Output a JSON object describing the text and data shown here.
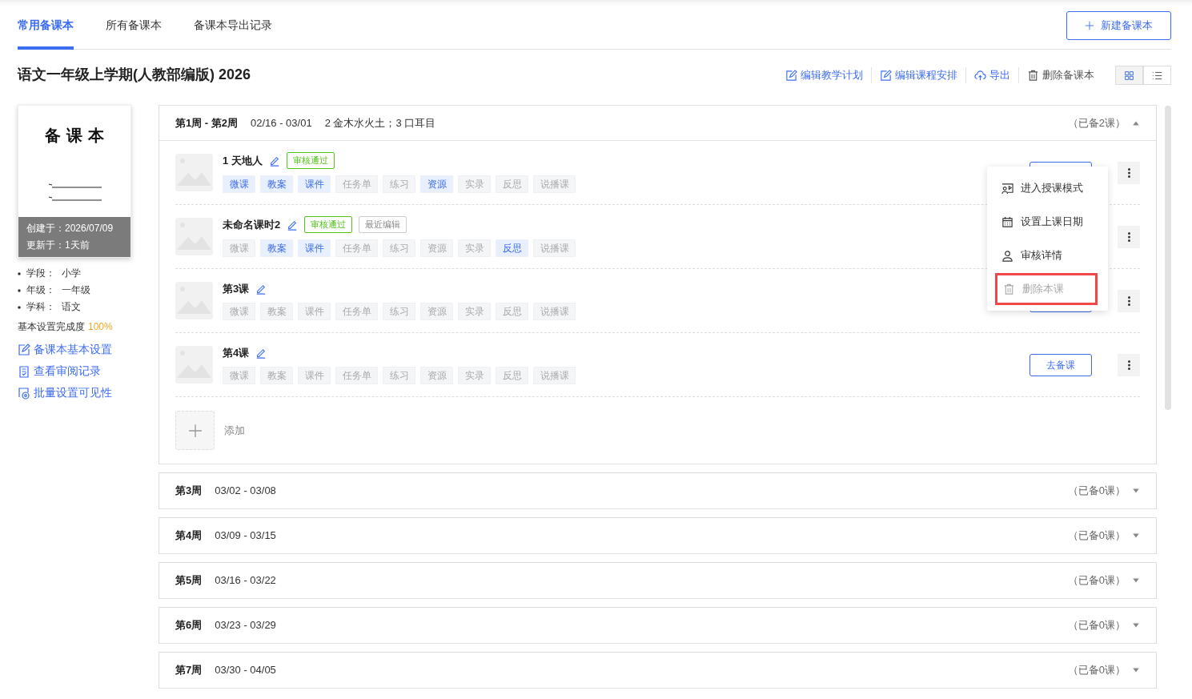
{
  "tabs": [
    {
      "label": "常用备课本",
      "selected": true
    },
    {
      "label": "所有备课本",
      "selected": false
    },
    {
      "label": "备课本导出记录",
      "selected": false
    }
  ],
  "new_button": {
    "label": "新建备课本"
  },
  "title": "语文一年级上学期(人教部编版) 2026",
  "actions": [
    {
      "label": "编辑教学计划",
      "kind": "edit"
    },
    {
      "label": "编辑课程安排",
      "kind": "edit"
    },
    {
      "label": "导出",
      "kind": "export"
    },
    {
      "label": "删除备课本",
      "kind": "delete"
    }
  ],
  "view_toggle": [
    {
      "kind": "grid",
      "selected": true
    },
    {
      "kind": "list",
      "selected": false
    }
  ],
  "cover": {
    "title": "备 课 本",
    "created": "创建于：2026/07/09",
    "updated": "更新于：1天前"
  },
  "info": [
    {
      "label": "学段：",
      "value": "小学"
    },
    {
      "label": "年级：",
      "value": "一年级"
    },
    {
      "label": "学科：",
      "value": "语文"
    }
  ],
  "completion": {
    "label": "基本设置完成度",
    "value": "100%"
  },
  "links": [
    {
      "label": "备课本基本设置",
      "kind": "settings"
    },
    {
      "label": "查看审阅记录",
      "kind": "record"
    },
    {
      "label": "批量设置可见性",
      "kind": "visibility"
    }
  ],
  "weeks": [
    {
      "name": "第1周 - 第2周",
      "dates": "02/16 - 03/01",
      "topics": "2 金木水火土；3 口耳目",
      "count": "（已备2课）",
      "expanded": true,
      "lessons": [
        {
          "title": "1 天地人",
          "badges": [
            {
              "label": "审核通过",
              "kind": "approved"
            }
          ],
          "tags": [
            {
              "label": "微课",
              "on": true
            },
            {
              "label": "教案",
              "on": true
            },
            {
              "label": "课件",
              "on": true
            },
            {
              "label": "任务单",
              "on": false
            },
            {
              "label": "练习",
              "on": false
            },
            {
              "label": "资源",
              "on": true
            },
            {
              "label": "实录",
              "on": false
            },
            {
              "label": "反思",
              "on": false
            },
            {
              "label": "说播课",
              "on": false
            }
          ]
        },
        {
          "title": "未命名课时2",
          "badges": [
            {
              "label": "审核通过",
              "kind": "approved"
            },
            {
              "label": "最近编辑",
              "kind": "recent"
            }
          ],
          "tags": [
            {
              "label": "微课",
              "on": false
            },
            {
              "label": "教案",
              "on": true
            },
            {
              "label": "课件",
              "on": true
            },
            {
              "label": "任务单",
              "on": false
            },
            {
              "label": "练习",
              "on": false
            },
            {
              "label": "资源",
              "on": false
            },
            {
              "label": "实录",
              "on": false
            },
            {
              "label": "反思",
              "on": true
            },
            {
              "label": "说播课",
              "on": false
            }
          ]
        },
        {
          "title": "第3课",
          "tags": [
            {
              "label": "微课",
              "on": false
            },
            {
              "label": "教案",
              "on": false
            },
            {
              "label": "课件",
              "on": false
            },
            {
              "label": "任务单",
              "on": false
            },
            {
              "label": "练习",
              "on": false
            },
            {
              "label": "资源",
              "on": false
            },
            {
              "label": "实录",
              "on": false
            },
            {
              "label": "反思",
              "on": false
            },
            {
              "label": "说播课",
              "on": false
            }
          ]
        },
        {
          "title": "第4课",
          "button": "去备课",
          "tags": [
            {
              "label": "微课",
              "on": false
            },
            {
              "label": "教案",
              "on": false
            },
            {
              "label": "课件",
              "on": false
            },
            {
              "label": "任务单",
              "on": false
            },
            {
              "label": "练习",
              "on": false
            },
            {
              "label": "资源",
              "on": false
            },
            {
              "label": "实录",
              "on": false
            },
            {
              "label": "反思",
              "on": false
            },
            {
              "label": "说播课",
              "on": false
            }
          ]
        }
      ],
      "add_label": "添加"
    },
    {
      "name": "第3周",
      "dates": "03/02 - 03/08",
      "count": "（已备0课）",
      "expanded": false
    },
    {
      "name": "第4周",
      "dates": "03/09 - 03/15",
      "count": "（已备0课）",
      "expanded": false
    },
    {
      "name": "第5周",
      "dates": "03/16 - 03/22",
      "count": "（已备0课）",
      "expanded": false
    },
    {
      "name": "第6周",
      "dates": "03/23 - 03/29",
      "count": "（已备0课）",
      "expanded": false
    },
    {
      "name": "第7周",
      "dates": "03/30 - 04/05",
      "count": "（已备0课）",
      "expanded": false
    }
  ],
  "menu": [
    {
      "label": "进入授课模式",
      "kind": "teach",
      "disabled": false,
      "highlighted": false
    },
    {
      "label": "设置上课日期",
      "kind": "date",
      "disabled": false,
      "highlighted": false
    },
    {
      "label": "审核详情",
      "kind": "review",
      "disabled": false,
      "highlighted": false
    },
    {
      "label": "删除本课",
      "kind": "delete",
      "disabled": true,
      "highlighted": true
    }
  ]
}
